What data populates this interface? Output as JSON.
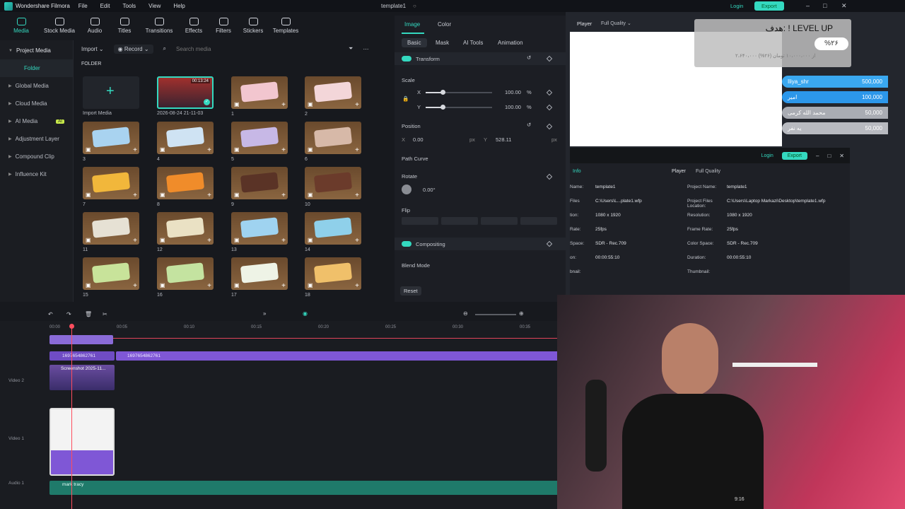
{
  "app": {
    "name": "Wondershare Filmora",
    "menu": [
      "File",
      "Edit",
      "Tools",
      "View",
      "Help"
    ],
    "project_title": "template1",
    "login_label": "Login",
    "export_label": "Export"
  },
  "toolbar": [
    {
      "label": "Media",
      "icon": "media-icon",
      "active": true
    },
    {
      "label": "Stock Media",
      "icon": "stock-media-icon"
    },
    {
      "label": "Audio",
      "icon": "audio-icon"
    },
    {
      "label": "Titles",
      "icon": "titles-icon"
    },
    {
      "label": "Transitions",
      "icon": "transitions-icon"
    },
    {
      "label": "Effects",
      "icon": "effects-icon"
    },
    {
      "label": "Filters",
      "icon": "filters-icon"
    },
    {
      "label": "Stickers",
      "icon": "stickers-icon"
    },
    {
      "label": "Templates",
      "icon": "templates-icon"
    }
  ],
  "sidenav": {
    "items": [
      "Project Media",
      "Folder",
      "Global Media",
      "Cloud Media",
      "AI Media",
      "Adjustment Layer",
      "Compound Clip",
      "Influence Kit"
    ],
    "ai_badge": "AI"
  },
  "media": {
    "import_label": "Import",
    "record_label": "Record",
    "search_placeholder": "Search media",
    "folder_label": "FOLDER",
    "import_media_label": "Import Media",
    "first_clip": {
      "name": "2026-08-24 21-11-03",
      "duration": "00:13:24"
    },
    "items": [
      "1",
      "2",
      "3",
      "4",
      "5",
      "6",
      "7",
      "8",
      "9",
      "10",
      "11",
      "12",
      "13",
      "14",
      "15",
      "16",
      "17",
      "18"
    ]
  },
  "props": {
    "tabs": [
      "Image",
      "Color"
    ],
    "subtabs": [
      "Basic",
      "Mask",
      "AI Tools",
      "Animation"
    ],
    "transform": "Transform",
    "scale": "Scale",
    "x": "X",
    "y": "Y",
    "scale_x": "100.00",
    "scale_y": "100.00",
    "percent": "%",
    "position": "Position",
    "pos_x": "0.00",
    "pos_y": "528.11",
    "px": "px",
    "path_curve": "Path Curve",
    "rotate": "Rotate",
    "rotate_val": "0.00°",
    "flip": "Flip",
    "compositing": "Compositing",
    "blend_mode": "Blend Mode",
    "reset": "Reset"
  },
  "player": {
    "tab": "Player",
    "quality": "Full Quality"
  },
  "overlay": {
    "goal_title": "هدف: ! LEVEL UP",
    "goal_percent": "%۲۶",
    "goal_progress": "۲،۶۴۰،۰۰۰ از ۱۰،۰۰۰،۰۰۰ تومان (۲۶%)",
    "donors": [
      {
        "name": "Iliya_shr",
        "amount": "500,000"
      },
      {
        "name": "امیر",
        "amount": "100,000"
      },
      {
        "name": "محمد الله کرمی",
        "amount": "50,000"
      },
      {
        "name": "یه نفر",
        "amount": "50,000"
      }
    ]
  },
  "info": {
    "left_title": "Info",
    "left_rows": [
      [
        "Name:",
        "template1"
      ],
      [
        "Files",
        "C:\\Users\\L...plate1.wfp"
      ],
      [
        "tion:",
        "1080 x 1920"
      ],
      [
        "Rate:",
        "25fps"
      ],
      [
        "Space:",
        "SDR - Rec.709"
      ],
      [
        "on:",
        "00:00:55:10"
      ],
      [
        "bnail:",
        ""
      ]
    ],
    "right_rows": [
      [
        "Project Name:",
        "template1"
      ],
      [
        "Project Files Location:",
        "C:\\Users\\Laptop Markazi\\Desktop\\template1.wfp"
      ],
      [
        "Resolution:",
        "1080 x 1920"
      ],
      [
        "Frame Rate:",
        "25fps"
      ],
      [
        "Color Space:",
        "SDR - Rec.709"
      ],
      [
        "Duration:",
        "00:00:55:10"
      ],
      [
        "Thumbnail:",
        ""
      ]
    ]
  },
  "timeline": {
    "ruler": [
      "00:00",
      "00:05",
      "00:10",
      "00:15",
      "00:20",
      "00:25",
      "00:30",
      "00:35"
    ],
    "tracks": [
      "Video 2",
      "Video 1",
      "Audio 1"
    ],
    "clip_a": "1697654862761",
    "clip_b": "1697654862761",
    "clip_shot": "Screenshot 2025-11...",
    "audio_clip": "mark tracy",
    "player_time": "9:16"
  },
  "colors": {
    "accent": "#34d9c0",
    "clip": "#7f57d6",
    "audio": "#1f7a6a"
  }
}
